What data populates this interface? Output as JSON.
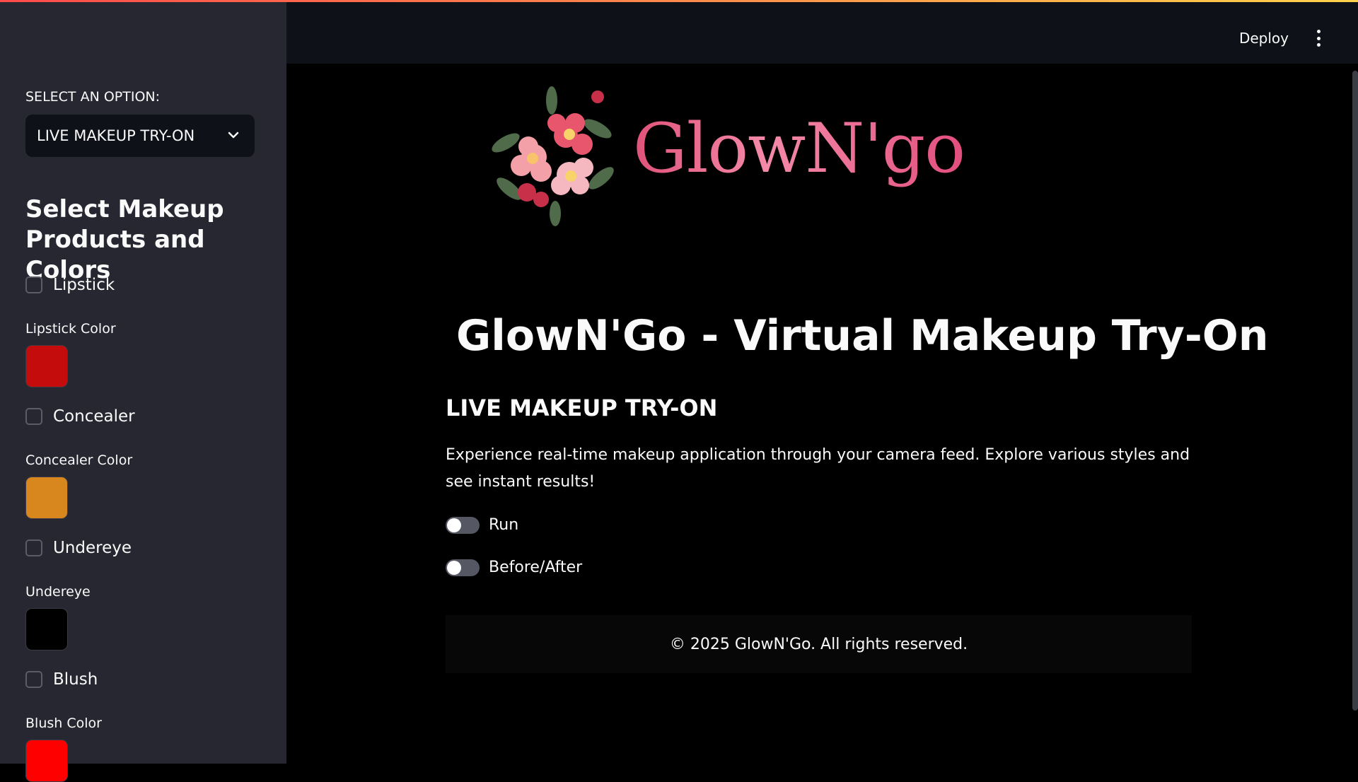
{
  "sidebar": {
    "select_label": "SELECT AN OPTION:",
    "select_value": "LIVE MAKEUP TRY-ON",
    "heading": "Select Makeup Products and Colors",
    "items": [
      {
        "checkbox_label": "Lipstick",
        "color_label": "Lipstick Color",
        "color": "#c40c0c"
      },
      {
        "checkbox_label": "Concealer",
        "color_label": "Concealer Color",
        "color": "#d8861e"
      },
      {
        "checkbox_label": "Undereye",
        "color_label": "Undereye",
        "color": "#000000"
      },
      {
        "checkbox_label": "Blush",
        "color_label": "Blush Color",
        "color": "#ff0000"
      }
    ]
  },
  "header": {
    "deploy_label": "Deploy",
    "menu_icon": "kebab-menu-icon"
  },
  "main": {
    "logo_text": "GlowN'go",
    "title": "GlowN'Go - Virtual Makeup Try-On",
    "subtitle": "LIVE MAKEUP TRY-ON",
    "description": "Experience real-time makeup application through your camera feed. Explore various styles and see instant results!",
    "toggles": [
      {
        "label": "Run",
        "on": false
      },
      {
        "label": "Before/After",
        "on": false
      }
    ],
    "footer": "© 2025 GlowN'Go. All rights reserved."
  }
}
